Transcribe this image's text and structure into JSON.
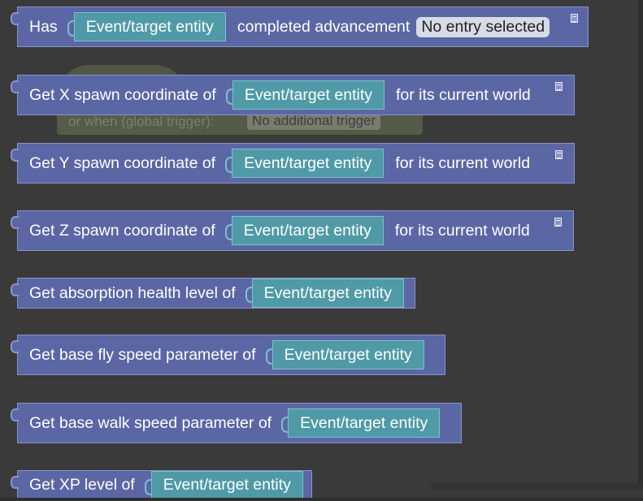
{
  "blocks": [
    {
      "pre": "Has",
      "entity": "Event/target entity",
      "post": "completed advancement",
      "selector": "No entry selected"
    },
    {
      "pre": "Get X spawn coordinate of",
      "entity": "Event/target entity",
      "post": "for its current world"
    },
    {
      "pre": "Get Y spawn coordinate of",
      "entity": "Event/target entity",
      "post": "for its current world"
    },
    {
      "pre": "Get Z spawn coordinate of",
      "entity": "Event/target entity",
      "post": "for its current world"
    },
    {
      "pre": "Get absorption health level of",
      "entity": "Event/target entity"
    },
    {
      "pre": "Get base fly speed parameter of",
      "entity": "Event/target entity"
    },
    {
      "pre": "Get base walk speed parameter of",
      "entity": "Event/target entity"
    },
    {
      "pre": "Get XP level of",
      "entity": "Event/target entity"
    }
  ],
  "ghost": {
    "text": "or when (global trigger):",
    "pill": "No additional trigger"
  },
  "icons": {
    "comment": "comment-icon"
  }
}
